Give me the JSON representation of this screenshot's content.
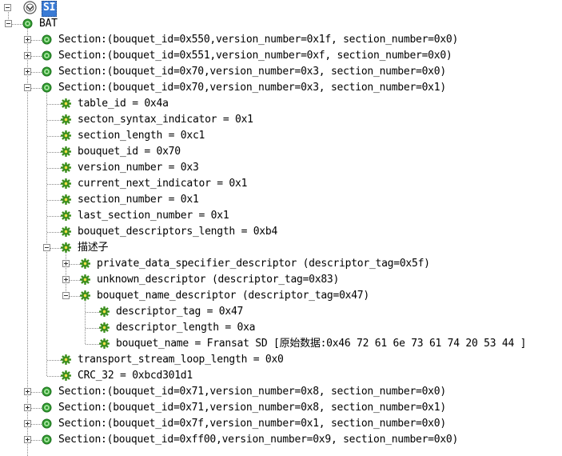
{
  "tree": {
    "root_label": "SI",
    "nodes": [
      {
        "label": "BAT",
        "expand": "minus",
        "icon": "green-node-icon"
      },
      {
        "label": "Section:(bouquet_id=0x550,version_number=0x1f, section_number=0x0)",
        "expand": "plus",
        "icon": "green-node-icon"
      },
      {
        "label": "Section:(bouquet_id=0x551,version_number=0xf, section_number=0x0)",
        "expand": "plus",
        "icon": "green-node-icon"
      },
      {
        "label": "Section:(bouquet_id=0x70,version_number=0x3, section_number=0x0)",
        "expand": "plus",
        "icon": "green-node-icon"
      },
      {
        "label": "Section:(bouquet_id=0x70,version_number=0x3, section_number=0x1)",
        "expand": "minus",
        "icon": "green-node-icon"
      },
      {
        "label": "table_id = 0x4a",
        "expand": "none",
        "icon": "gear-icon"
      },
      {
        "label": "secton_syntax_indicator = 0x1",
        "expand": "none",
        "icon": "gear-icon"
      },
      {
        "label": "section_length = 0xc1",
        "expand": "none",
        "icon": "gear-icon"
      },
      {
        "label": "bouquet_id = 0x70",
        "expand": "none",
        "icon": "gear-icon"
      },
      {
        "label": "version_number = 0x3",
        "expand": "none",
        "icon": "gear-icon"
      },
      {
        "label": "current_next_indicator = 0x1",
        "expand": "none",
        "icon": "gear-icon"
      },
      {
        "label": "section_number = 0x1",
        "expand": "none",
        "icon": "gear-icon"
      },
      {
        "label": "last_section_number = 0x1",
        "expand": "none",
        "icon": "gear-icon"
      },
      {
        "label": "bouquet_descriptors_length = 0xb4",
        "expand": "none",
        "icon": "gear-icon"
      },
      {
        "label": "描述子",
        "expand": "minus",
        "icon": "gear-icon"
      },
      {
        "label": "private_data_specifier_descriptor (descriptor_tag=0x5f)",
        "expand": "plus",
        "icon": "gear-icon"
      },
      {
        "label": "unknown_descriptor (descriptor_tag=0x83)",
        "expand": "plus",
        "icon": "gear-icon"
      },
      {
        "label": "bouquet_name_descriptor (descriptor_tag=0x47)",
        "expand": "minus",
        "icon": "gear-icon"
      },
      {
        "label": "descriptor_tag = 0x47",
        "expand": "none",
        "icon": "gear-icon"
      },
      {
        "label": "descriptor_length = 0xa",
        "expand": "none",
        "icon": "gear-icon"
      },
      {
        "label": "bouquet_name = Fransat SD [原始数据:0x46 72 61 6e 73 61 74 20 53 44 ]",
        "expand": "none",
        "icon": "gear-icon"
      },
      {
        "label": "transport_stream_loop_length = 0x0",
        "expand": "none",
        "icon": "gear-icon"
      },
      {
        "label": "CRC_32 = 0xbcd301d1",
        "expand": "none",
        "icon": "gear-icon"
      },
      {
        "label": "Section:(bouquet_id=0x71,version_number=0x8, section_number=0x0)",
        "expand": "plus",
        "icon": "green-node-icon"
      },
      {
        "label": "Section:(bouquet_id=0x71,version_number=0x8, section_number=0x1)",
        "expand": "plus",
        "icon": "green-node-icon"
      },
      {
        "label": "Section:(bouquet_id=0x7f,version_number=0x1, section_number=0x0)",
        "expand": "plus",
        "icon": "green-node-icon"
      },
      {
        "label": "Section:(bouquet_id=0xff00,version_number=0x9, section_number=0x0)",
        "expand": "plus",
        "icon": "green-node-icon"
      }
    ]
  },
  "colors": {
    "selection": "#3a7bd5",
    "node_green": "#2f9a2f",
    "gear_green": "#3d8f1f"
  }
}
